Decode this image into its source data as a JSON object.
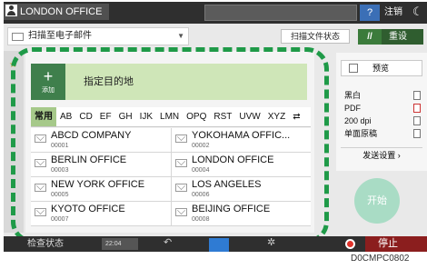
{
  "topbar": {
    "user_label": "LONDON OFFICE",
    "help_label": "?",
    "logout_label": "注销",
    "moon_icon": "moon-icon"
  },
  "toolbar": {
    "app_label": "扫描至电子邮件",
    "status_label": "扫描文件状态",
    "reset_label": "重设",
    "reset_symbol": "//"
  },
  "destination": {
    "add_symbol": "+",
    "add_label": "添加",
    "header_label": "指定目的地"
  },
  "tabs": [
    "常用",
    "AB",
    "CD",
    "EF",
    "GH",
    "IJK",
    "LMN",
    "OPQ",
    "RST",
    "UVW",
    "XYZ",
    "⇄"
  ],
  "entries": [
    [
      {
        "name": "ABCD COMPANY",
        "num": "00001"
      },
      {
        "name": "YOKOHAMA OFFIC...",
        "num": "00002"
      }
    ],
    [
      {
        "name": "BERLIN OFFICE",
        "num": "00003"
      },
      {
        "name": "LONDON OFFICE",
        "num": "00004"
      }
    ],
    [
      {
        "name": "NEW YORK OFFICE",
        "num": "00005"
      },
      {
        "name": "LOS ANGELES",
        "num": "00006"
      }
    ],
    [
      {
        "name": "KYOTO OFFICE",
        "num": "00007"
      },
      {
        "name": "BEIJING OFFICE",
        "num": "00008"
      }
    ]
  ],
  "right_panel": {
    "preview_label": "预览",
    "settings": [
      "黑白",
      "PDF",
      "200 dpi",
      "单面原稿"
    ],
    "send_settings_label": "发送设置",
    "start_label": "开始"
  },
  "bottombar": {
    "status_label": "检查状态",
    "time": "22:04",
    "stop_label": "停止"
  },
  "caption": "D0CMPC0802",
  "colors": {
    "accent_green": "#3f7f4c",
    "dashed_frame": "#1f9a48",
    "stop_red": "#8b1e1e"
  }
}
